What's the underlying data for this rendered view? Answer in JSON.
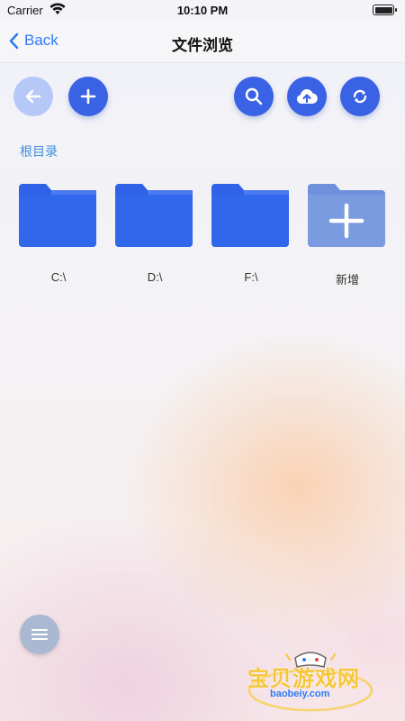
{
  "status_bar": {
    "carrier": "Carrier",
    "time": "10:10 PM"
  },
  "nav": {
    "back_label": "Back",
    "title": "文件浏览"
  },
  "toolbar": {
    "left": [
      {
        "icon": "arrow-left-icon",
        "enabled": false
      },
      {
        "icon": "plus-icon",
        "enabled": true
      }
    ],
    "right": [
      {
        "icon": "search-icon"
      },
      {
        "icon": "cloud-upload-icon"
      },
      {
        "icon": "refresh-icon"
      }
    ]
  },
  "breadcrumb": "根目录",
  "folders": [
    {
      "label": "C:\\",
      "icon": "folder-icon"
    },
    {
      "label": "D:\\",
      "icon": "folder-icon"
    },
    {
      "label": "F:\\",
      "icon": "folder-icon"
    },
    {
      "label": "新增",
      "icon": "folder-add-icon"
    }
  ],
  "fab": {
    "icon": "menu-icon"
  },
  "watermark": {
    "text": "宝贝游戏网",
    "url": "baobeiy.com"
  },
  "colors": {
    "accent": "#3a62e4",
    "accent_disabled": "#b6c8f8",
    "folder": "#2f62e8",
    "folder_tab": "#4a79f0",
    "folder_add": "#7b9be0",
    "link": "#2f7cf6",
    "breadcrumb": "#3e8fe0"
  }
}
